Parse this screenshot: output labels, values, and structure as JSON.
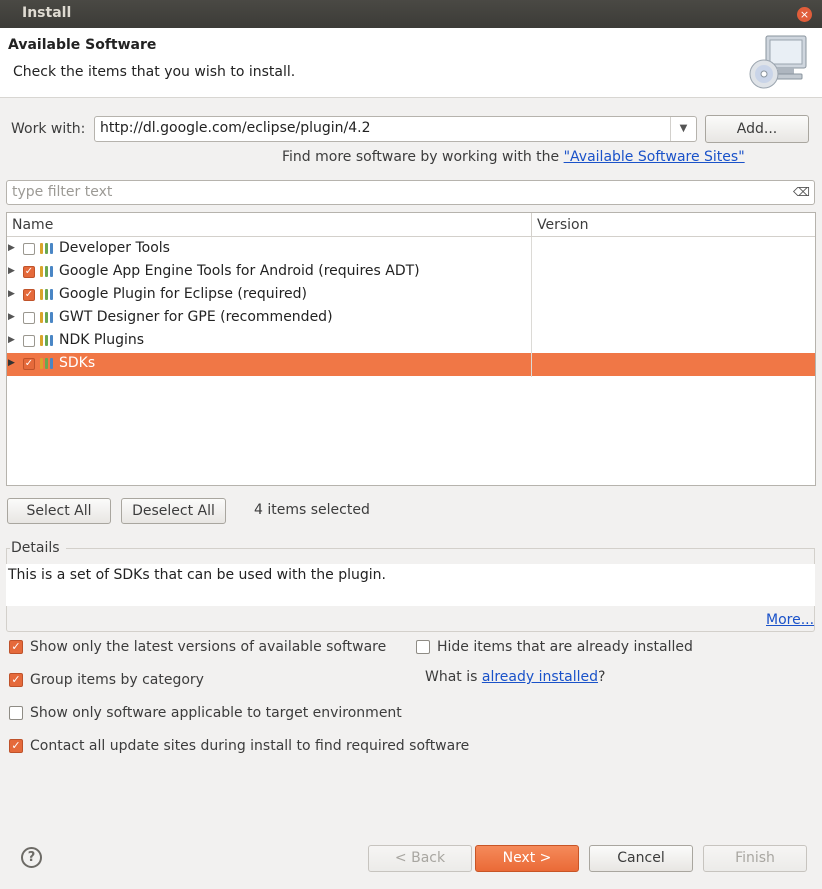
{
  "window": {
    "title": "Install"
  },
  "banner": {
    "title": "Available Software",
    "subtitle": "Check the items that you wish to install."
  },
  "work_with": {
    "label": "Work with:",
    "value": "http://dl.google.com/eclipse/plugin/4.2",
    "add_label": "Add...",
    "hint_prefix": "Find more software by working with the ",
    "hint_link": "\"Available Software Sites\""
  },
  "filter": {
    "placeholder": "type filter text"
  },
  "table": {
    "columns": [
      "Name",
      "Version"
    ],
    "rows": [
      {
        "label": "Developer Tools",
        "checked": false,
        "selected": false
      },
      {
        "label": "Google App Engine Tools for Android (requires ADT)",
        "checked": true,
        "selected": false
      },
      {
        "label": "Google Plugin for Eclipse (required)",
        "checked": true,
        "selected": false
      },
      {
        "label": "GWT Designer for GPE (recommended)",
        "checked": false,
        "selected": false
      },
      {
        "label": "NDK Plugins",
        "checked": false,
        "selected": false
      },
      {
        "label": "SDKs",
        "checked": true,
        "selected": true
      }
    ]
  },
  "selection": {
    "select_all": "Select All",
    "deselect_all": "Deselect All",
    "count_text": "4 items selected"
  },
  "details": {
    "label": "Details",
    "text": "This is a set of SDKs that can be used with the plugin.",
    "more_link": "More..."
  },
  "options": {
    "latest_only": {
      "label": "Show only the latest versions of available software",
      "checked": true
    },
    "hide_installed": {
      "label": "Hide items that are already installed",
      "checked": false
    },
    "group_by_category": {
      "label": "Group items by category",
      "checked": true
    },
    "target_env": {
      "label": "Show only software applicable to target environment",
      "checked": false
    },
    "contact_sites": {
      "label": "Contact all update sites during install to find required software",
      "checked": true
    },
    "what_is_prefix": "What is ",
    "already_installed_link": "already installed",
    "what_is_suffix": "?"
  },
  "footer": {
    "help": "?",
    "back": "< Back",
    "next": "Next >",
    "cancel": "Cancel",
    "finish": "Finish"
  },
  "colors": {
    "accent": "#f07746",
    "link": "#1a52c9",
    "titlebar": "#3c3b37"
  }
}
